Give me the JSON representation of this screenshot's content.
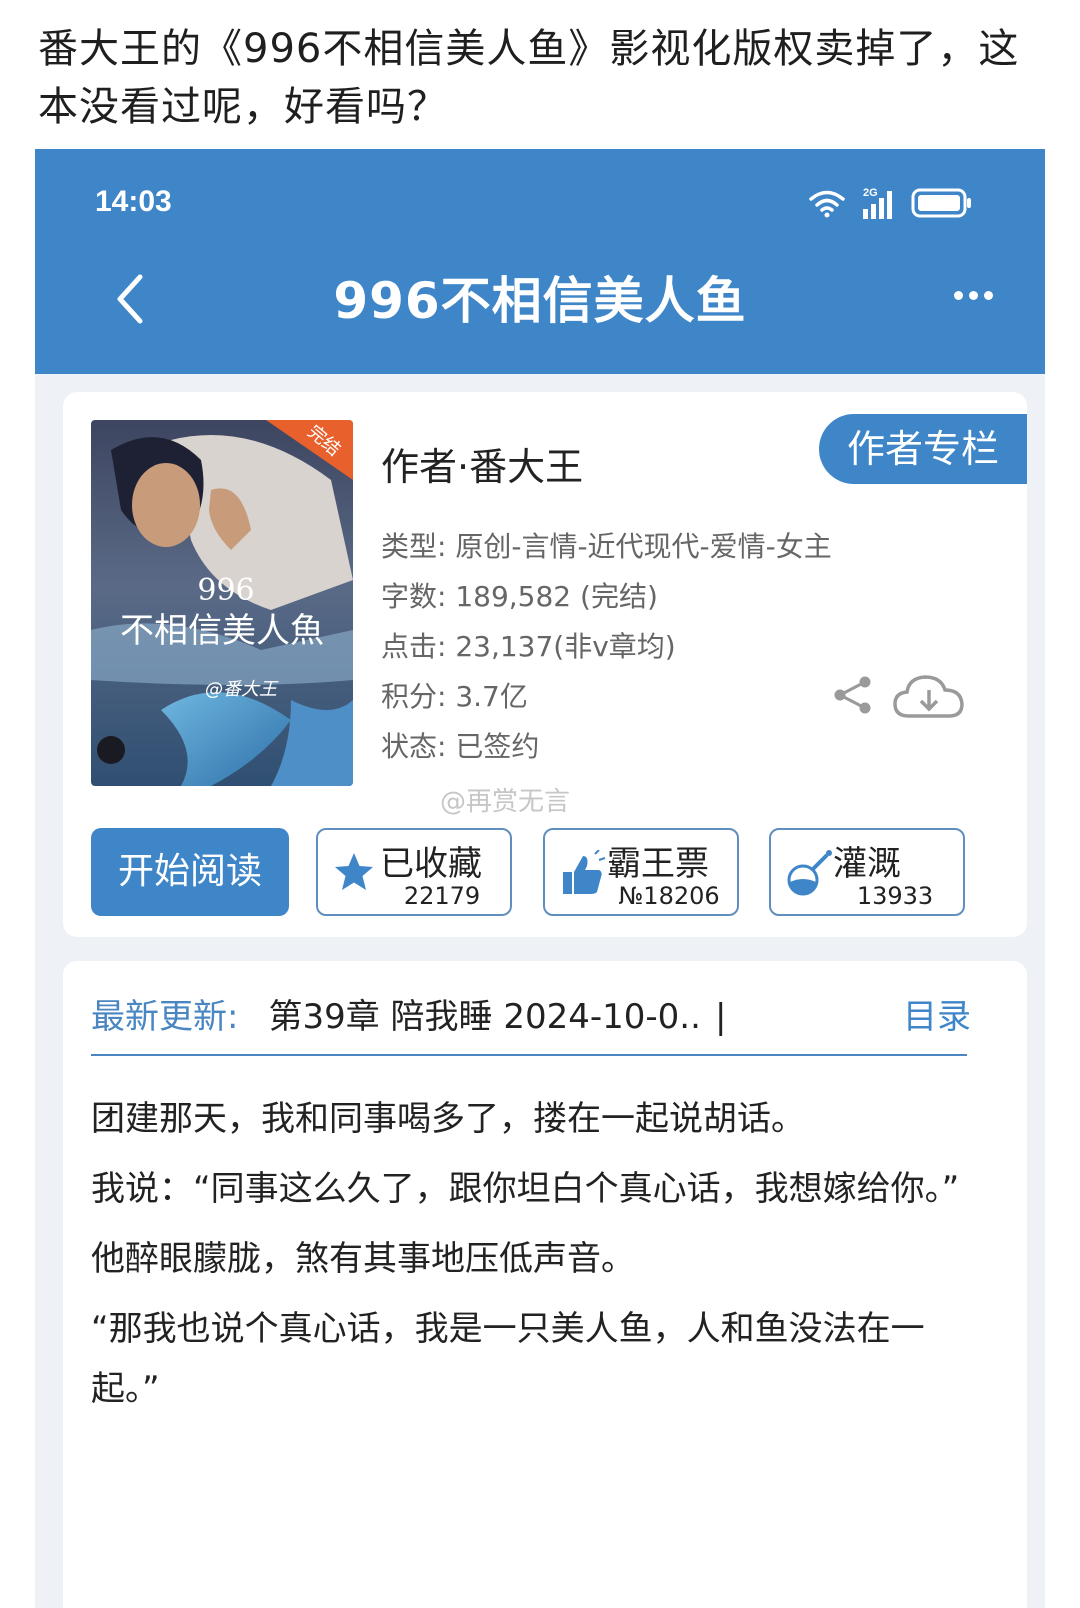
{
  "post": {
    "title": "番大王的《996不相信美人鱼》影视化版权卖掉了，这本没看过呢，好看吗？"
  },
  "status_bar": {
    "time": "14:03",
    "network": "2G"
  },
  "app_bar": {
    "title": "996不相信美人鱼"
  },
  "book": {
    "cover_badge": "完结",
    "cover_title_line1": "996",
    "cover_title_line2": "不相信美人魚",
    "cover_signature": "@番大王",
    "author": "作者·番大王",
    "author_column_button": "作者专栏",
    "meta": {
      "type": "类型: 原创-言情-近代现代-爱情-女主",
      "words": "字数: 189,582 (完结)",
      "clicks": "点击: 23,137(非v章均)",
      "score": "积分: 3.7亿",
      "status": "状态: 已签约"
    }
  },
  "watermark": "@再赏无言",
  "actions": {
    "read_button": "开始阅读",
    "collect": {
      "label": "已收藏",
      "count": "22179"
    },
    "ticket": {
      "label": "霸王票",
      "count": "№18206"
    },
    "irrigate": {
      "label": "灌溉",
      "count": "13933"
    }
  },
  "latest_update": {
    "label": "最新更新:",
    "chapter": "第39章  陪我睡  2024-10-0..",
    "separator": "|",
    "toc_link": "目录"
  },
  "excerpt": [
    "团建那天，我和同事喝多了，搂在一起说胡话。",
    "我说：“同事这么久了，跟你坦白个真心话，我想嫁给你。”",
    "他醉眼朦胧，煞有其事地压低声音。",
    "“那我也说个真心话，我是一只美人鱼，人和鱼没法在一起。”"
  ],
  "colors": {
    "brand_blue": "#3f86c9",
    "label_blue": "#4a86c2",
    "page_bg": "#eef1f5"
  }
}
